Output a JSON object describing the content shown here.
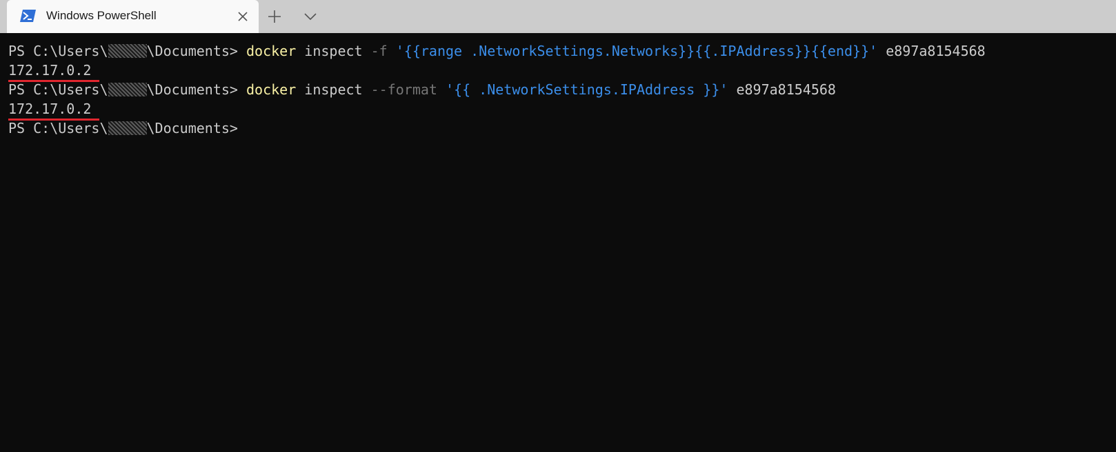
{
  "tab": {
    "title": "Windows PowerShell",
    "icon": "powershell-icon",
    "close_icon": "close-icon"
  },
  "tabbar": {
    "new_tab_icon": "plus-icon",
    "dropdown_icon": "chevron-down-icon"
  },
  "colors": {
    "background": "#0c0c0c",
    "text": "#cccccc",
    "command": "#f9f1a5",
    "parameter": "#767676",
    "string": "#3b8eea",
    "underline": "#e0262f"
  },
  "terminal": {
    "lines": [
      {
        "prompt_prefix": "PS C:\\Users\\",
        "prompt_suffix": "\\Documents> ",
        "command": "docker",
        "args": " inspect ",
        "flag": "-f",
        "space": " ",
        "string": "'{{range .NetworkSettings.Networks}}{{.IPAddress}}{{end}}'",
        "tail": " e897a8154568"
      },
      {
        "output": "172.17.0.2"
      },
      {
        "prompt_prefix": "PS C:\\Users\\",
        "prompt_suffix": "\\Documents> ",
        "command": "docker",
        "args": " inspect ",
        "flag": "--format",
        "space": " ",
        "string": "'{{ .NetworkSettings.IPAddress }}'",
        "tail": " e897a8154568"
      },
      {
        "output": "172.17.0.2"
      },
      {
        "prompt_prefix": "PS C:\\Users\\",
        "prompt_suffix": "\\Documents>"
      }
    ]
  }
}
